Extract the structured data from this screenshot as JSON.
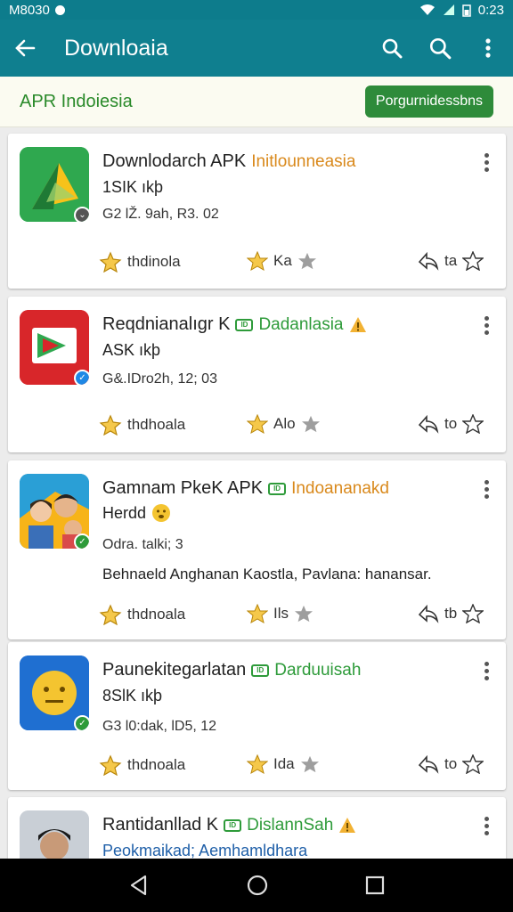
{
  "status": {
    "left_text": "M8030",
    "time": "0:23"
  },
  "appbar": {
    "title": "Downloaia"
  },
  "subbar": {
    "title": "APR Indoiesia",
    "button": "Porgurnidessbns"
  },
  "apps": [
    {
      "name": "Downlodarch APK",
      "category": "Initlounneasia",
      "category_color": "#d9891c",
      "tag": "",
      "warn": false,
      "info": "1SIK ıkþ",
      "meta": "G2 lŽ. 9ah, R3. 02",
      "desc": "",
      "install_label": "thdinola",
      "rating_label": "Ka",
      "share_label": "ta",
      "icon": "green-yellow-arrow-icon",
      "badge_color": "#555555"
    },
    {
      "name": "Reqdnianalıgr K",
      "category": "Dadanlasia",
      "category_color": "#2e9b3a",
      "tag": "ID",
      "warn": true,
      "info": "ASK ıkþ",
      "meta": "G&.IDro2h, 12; 03",
      "desc": "",
      "install_label": "thdhoala",
      "rating_label": "Alo",
      "share_label": "to",
      "icon": "red-play-icon",
      "badge_color": "#1e88e5"
    },
    {
      "name": "Gamnam PkeK APK",
      "category": "Indoananakd",
      "category_color": "#d9891c",
      "tag": "ID",
      "warn": false,
      "name_line2": "Herdd",
      "info": "",
      "meta": "Odra. talki; 3",
      "desc": "Behnaeld Anghanan Kaostla, Pavlana: hanansar.",
      "install_label": "thdnoala",
      "rating_label": "Ils",
      "share_label": "tb",
      "icon": "people-game-icon",
      "badge_color": "#2e9b3a"
    },
    {
      "name": "Paunekitegarlatan",
      "category": "Darduuisah",
      "category_color": "#2e9b3a",
      "tag": "ID",
      "warn": false,
      "info": "8SlK ıkþ",
      "meta": "G3 l0:dak, lD5, 12",
      "desc": "",
      "install_label": "thdnoala",
      "rating_label": "Ida",
      "share_label": "to",
      "icon": "yellow-face-icon",
      "badge_color": "#2e9b3a"
    },
    {
      "name": "Rantidanllad K",
      "category": "DislannSah",
      "category_color": "#2e9b3a",
      "tag": "ID",
      "warn": true,
      "info": "Peokmaikad; Aemhamldhara",
      "meta": "",
      "desc": "",
      "install_label": "",
      "rating_label": "",
      "share_label": "",
      "icon": "person-photo-icon",
      "badge_color": "#2e9b3a"
    }
  ],
  "colors": {
    "teal": "#0f7f8f",
    "green": "#2e8b3a",
    "orange": "#d9891c"
  }
}
